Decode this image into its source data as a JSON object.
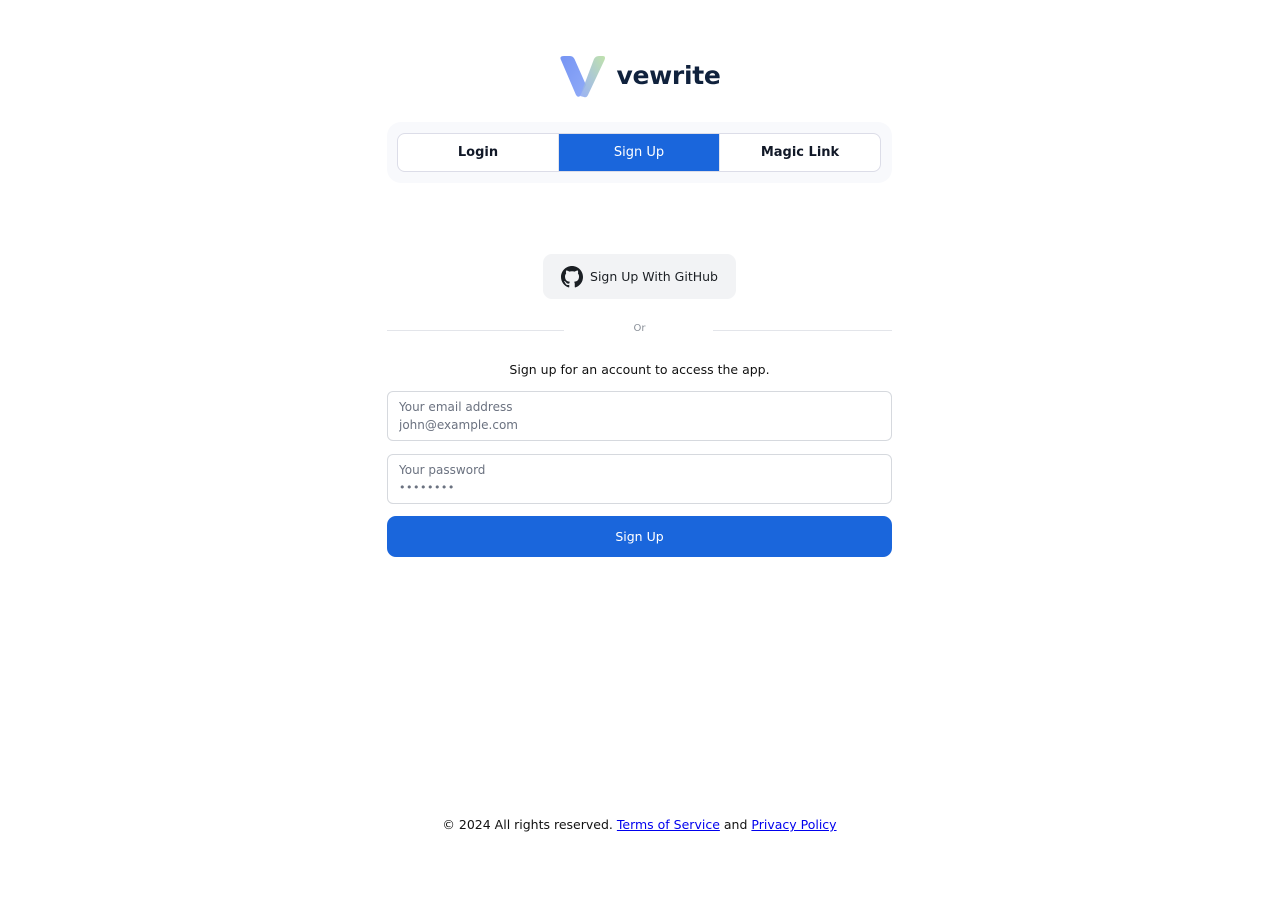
{
  "brand": {
    "name": "vewrite",
    "logo_icon": "v-logo-icon",
    "colors": {
      "gradient_start": "#7c9cf5",
      "gradient_end": "#b6e0a4",
      "text": "#10223d"
    }
  },
  "tabs": [
    {
      "label": "Login",
      "active": false
    },
    {
      "label": "Sign Up",
      "active": true
    },
    {
      "label": "Magic Link",
      "active": false
    }
  ],
  "github": {
    "label": "Sign Up With GitHub",
    "icon": "github-icon"
  },
  "divider": {
    "label": "Or"
  },
  "form": {
    "subtitle": "Sign up for an account to access the app.",
    "email": {
      "label": "Your email address",
      "placeholder": "john@example.com",
      "value": ""
    },
    "password": {
      "label": "Your password",
      "placeholder": "••••••••",
      "value": ""
    },
    "submit_label": "Sign Up"
  },
  "footer": {
    "copyright": "© 2024 All rights reserved.",
    "terms": "Terms of Service",
    "conjunction": "and",
    "privacy": "Privacy Policy"
  },
  "colors": {
    "primary": "#1a66dc",
    "link": "#0000ee"
  }
}
